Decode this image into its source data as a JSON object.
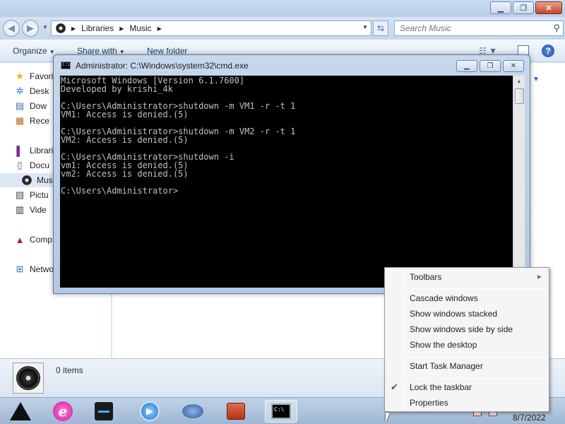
{
  "explorer": {
    "address": {
      "crumbs": [
        "Libraries",
        "Music"
      ]
    },
    "search": {
      "placeholder": "Search Music"
    },
    "toolbar": {
      "organize": "Organize",
      "share_with": "Share with",
      "new_folder": "New folder"
    },
    "nav": {
      "favorites": "Favorit",
      "desktop": "Desk",
      "downloads": "Dow",
      "recent": "Rece",
      "libraries": "Librari",
      "documents": "Docu",
      "music": "Mus",
      "pictures": "Pictu",
      "videos": "Vide",
      "computer": "Comp",
      "network": "Netwo"
    },
    "details": {
      "items": "0 items"
    }
  },
  "cmd": {
    "title": "Administrator: C:\\Windows\\system32\\cmd.exe",
    "lines": [
      "Microsoft Windows [Version 6.1.7600]",
      "Developed by krishi_4k",
      "",
      "C:\\Users\\Administrator>shutdown -m VM1 -r -t 1",
      "VM1: Access is denied.(5)",
      "",
      "C:\\Users\\Administrator>shutdown -m VM2 -r -t 1",
      "VM2: Access is denied.(5)",
      "",
      "C:\\Users\\Administrator>shutdown -i",
      "vm1: Access is denied.(5)",
      "vm2: Access is denied.(5)",
      "",
      "C:\\Users\\Administrator>"
    ]
  },
  "context_menu": {
    "toolbars": "Toolbars",
    "cascade": "Cascade windows",
    "stacked": "Show windows stacked",
    "side_by_side": "Show windows side by side",
    "show_desktop": "Show the desktop",
    "task_manager": "Start Task Manager",
    "lock_taskbar": "Lock the taskbar",
    "lock_taskbar_checked": true,
    "properties": "Properties"
  },
  "taskbar": {
    "date": "8/7/2022",
    "apps": [
      "start-logo",
      "internet-explorer",
      "explorer",
      "media-player",
      "network-tool",
      "toolbox",
      "command-prompt"
    ]
  },
  "colors": {
    "console_bg": "#000000",
    "console_fg": "#c0c0c0"
  }
}
